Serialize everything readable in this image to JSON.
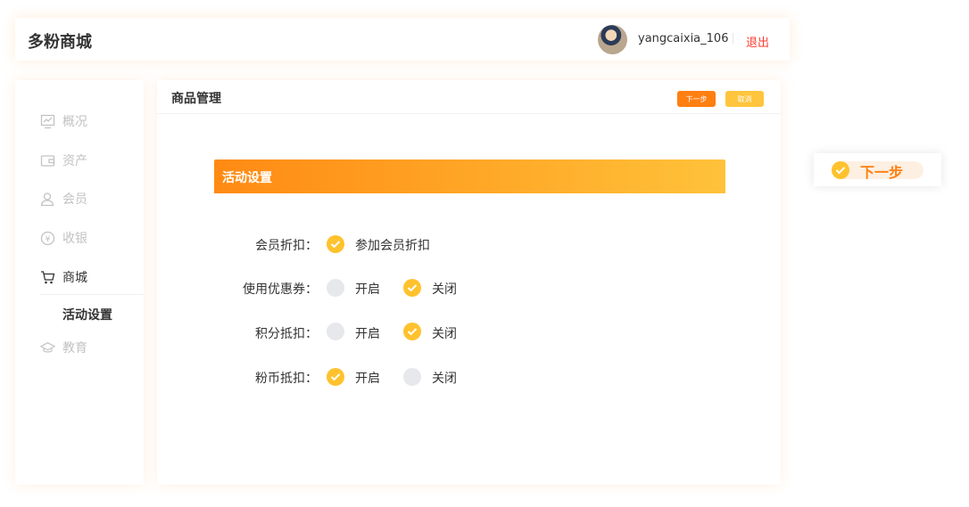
{
  "header": {
    "brand": "多粉商城",
    "username": "yangcaixia_106",
    "logout_label": "退出"
  },
  "sidebar": {
    "items": [
      {
        "label": "概况",
        "icon": "chart-icon"
      },
      {
        "label": "资产",
        "icon": "wallet-icon"
      },
      {
        "label": "会员",
        "icon": "user-icon"
      },
      {
        "label": "收银",
        "icon": "yen-icon"
      },
      {
        "label": "商城",
        "icon": "cart-icon"
      },
      {
        "label": "教育",
        "icon": "graduation-cap-icon"
      }
    ],
    "sub_item": "活动设置"
  },
  "main": {
    "title": "商品管理",
    "next_label": "下一步",
    "cancel_label": "取消",
    "section_title": "活动设置",
    "rows": [
      {
        "label": "会员折扣：",
        "options": [
          {
            "text": "参加会员折扣",
            "checked": true
          }
        ]
      },
      {
        "label": "使用优惠券：",
        "options": [
          {
            "text": "开启",
            "checked": false
          },
          {
            "text": "关闭",
            "checked": true
          }
        ]
      },
      {
        "label": "积分抵扣：",
        "options": [
          {
            "text": "开启",
            "checked": false
          },
          {
            "text": "关闭",
            "checked": true
          }
        ]
      },
      {
        "label": "粉币抵扣：",
        "options": [
          {
            "text": "开启",
            "checked": true
          },
          {
            "text": "关闭",
            "checked": false
          }
        ]
      }
    ]
  },
  "floating": {
    "next_label": "下一步"
  },
  "colors": {
    "accent_orange": "#ff7f11",
    "accent_yellow": "#ffc22e",
    "logout_red": "#ff3b30"
  }
}
